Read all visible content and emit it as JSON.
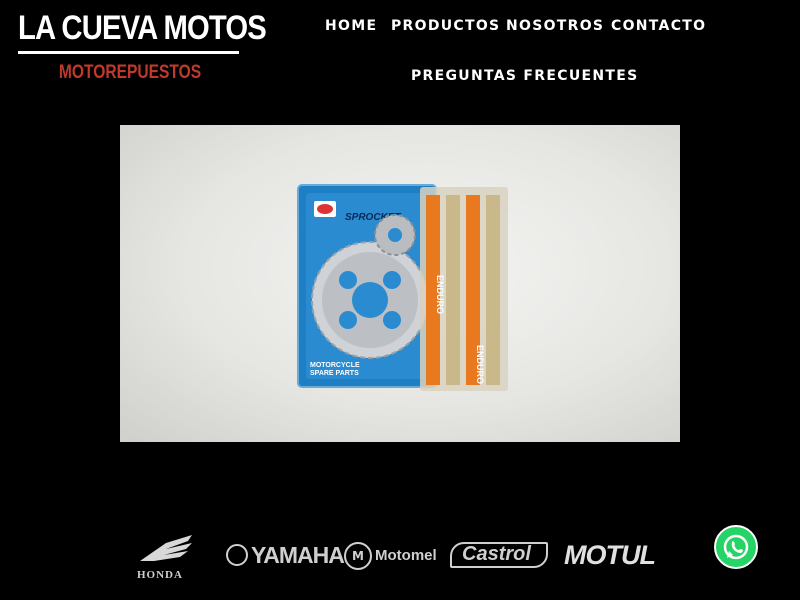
{
  "header": {
    "logo_title": "LA CUEVA MOTOS",
    "logo_subtitle": "MOTOREPUESTOS",
    "nav": {
      "home": "HOME",
      "products": "PRODUCTOS",
      "about": "NOSOTROS",
      "contact": "CONTACTO",
      "faq": "PREGUNTAS FRECUENTES"
    }
  },
  "hero": {
    "package_label": "SPROCKET",
    "package_caption_1": "MOTORCYCLE",
    "package_caption_2": "SPARE PARTS",
    "chain_brand": "ENDURO"
  },
  "brands": {
    "honda": "HONDA",
    "yamaha": "YAMAHA",
    "motomel": "Motomel",
    "castrol": "Castrol",
    "motul": "MOTUL"
  },
  "colors": {
    "background": "#000000",
    "accent_red": "#c0392b",
    "whatsapp_green": "#25d366",
    "package_blue": "#1f7fc4",
    "chain_orange": "#e8791f"
  },
  "icons": {
    "whatsapp": "whatsapp-icon"
  }
}
